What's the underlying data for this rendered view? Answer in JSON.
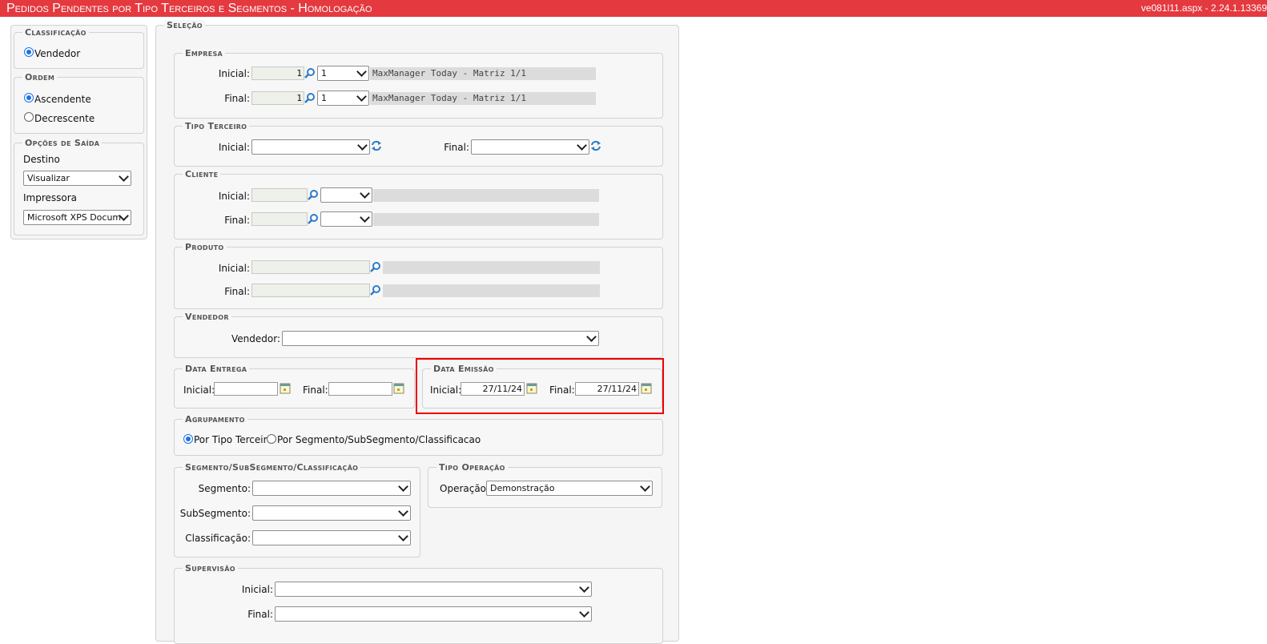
{
  "title": "Pedidos Pendentes por Tipo Terceiros e Segmentos  - Homologação",
  "version": "ve081l11.aspx - 2.24.1.13369",
  "left": {
    "classificacao": {
      "legend": "Classificação",
      "options": [
        "Vendedor"
      ]
    },
    "ordem": {
      "legend": "Ordem",
      "options": [
        "Ascendente",
        "Decrescente"
      ]
    },
    "saida": {
      "legend": "Opções de Saída",
      "destino_label": "Destino",
      "destino_value": "Visualizar",
      "impressora_label": "Impressora",
      "impressora_value": "Microsoft XPS Docum"
    }
  },
  "selecao": {
    "legend": "Seleção",
    "empresa": {
      "legend": "Empresa",
      "inicial_label": "Inicial:",
      "final_label": "Final:",
      "inicial_code": "1",
      "inicial_select": "1",
      "inicial_desc": "MaxManager Today - Matriz 1/1",
      "final_code": "1",
      "final_select": "1",
      "final_desc": "MaxManager Today - Matriz 1/1"
    },
    "tipo_terceiro": {
      "legend": "Tipo Terceiro",
      "inicial_label": "Inicial:",
      "final_label": "Final:"
    },
    "cliente": {
      "legend": "Cliente",
      "inicial_label": "Inicial:",
      "final_label": "Final:"
    },
    "produto": {
      "legend": "Produto",
      "inicial_label": "Inicial:",
      "final_label": "Final:"
    },
    "vendedor": {
      "legend": "Vendedor",
      "label": "Vendedor:"
    },
    "data_entrega": {
      "legend": "Data Entrega",
      "inicial_label": "Inicial:",
      "final_label": "Final:",
      "inicial_value": "",
      "final_value": ""
    },
    "data_emissao": {
      "legend": "Data Emissão",
      "inicial_label": "Inicial:",
      "final_label": "Final:",
      "inicial_value": "27/11/24",
      "final_value": "27/11/24"
    },
    "agrupamento": {
      "legend": "Agrupamento",
      "option1": "Por Tipo Terceiro",
      "option2": "Por Segmento/SubSegmento/Classificacao"
    },
    "segmento": {
      "legend": "Segmento/SubSegmento/Classificação",
      "segmento_label": "Segmento:",
      "subsegmento_label": "SubSegmento:",
      "classificacao_label": "Classificação:"
    },
    "tipo_operacao": {
      "legend": "Tipo Operação",
      "label": "Operação:",
      "value": "Demonstração"
    },
    "supervisao": {
      "legend": "Supervisão",
      "inicial_label": "Inicial:",
      "final_label": "Final:"
    }
  },
  "colors": {
    "title_bg": "#e4393f",
    "highlight": "#ee0000",
    "radio": "#1a73e8"
  }
}
